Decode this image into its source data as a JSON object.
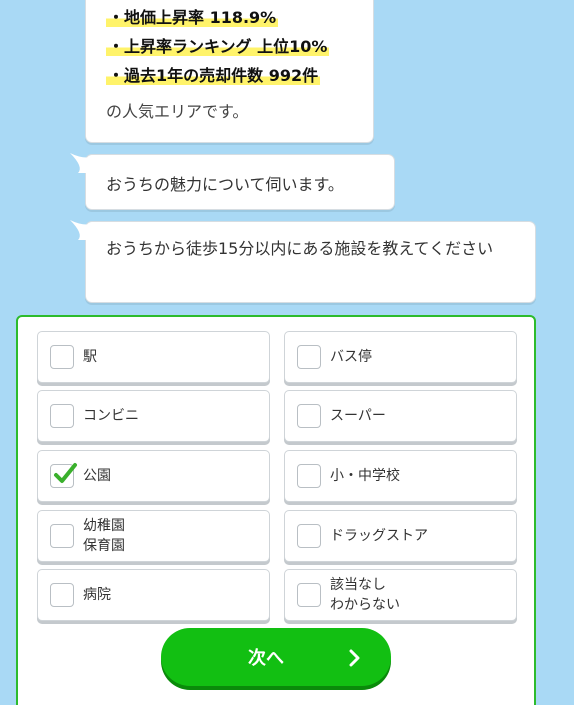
{
  "stats_bubble": {
    "lines": [
      "・地価上昇率 118.9%",
      "・上昇率ランキング 上位10%",
      "・過去1年の売却件数 992件"
    ],
    "tail_text": "の人気エリアです。"
  },
  "question1": "おうちの魅力について伺います。",
  "question2": "おうちから徒歩15分以内にある施設を教えてください",
  "options": [
    {
      "label": "駅",
      "checked": false
    },
    {
      "label": "バス停",
      "checked": false
    },
    {
      "label": "コンビニ",
      "checked": false
    },
    {
      "label": "スーパー",
      "checked": false
    },
    {
      "label": "公園",
      "checked": true
    },
    {
      "label": "小・中学校",
      "checked": false
    },
    {
      "label": "幼稚園\n保育園",
      "checked": false
    },
    {
      "label": "ドラッグストア",
      "checked": false
    },
    {
      "label": "病院",
      "checked": false
    },
    {
      "label": "該当なし\nわからない",
      "checked": false
    }
  ],
  "next_button": {
    "label": "次へ"
  },
  "colors": {
    "background": "#a9d9f5",
    "accent_green": "#12bf12",
    "highlight": "#fff36a",
    "check": "#3ab02c"
  }
}
